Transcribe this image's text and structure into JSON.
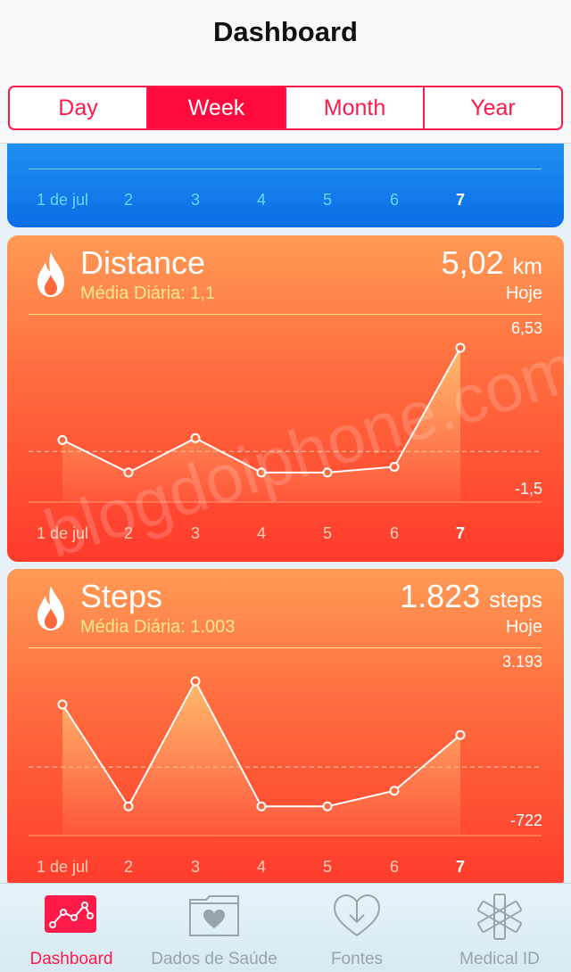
{
  "header": {
    "title": "Dashboard"
  },
  "segments": [
    {
      "label": "Day",
      "active": false
    },
    {
      "label": "Week",
      "active": true
    },
    {
      "label": "Month",
      "active": false
    },
    {
      "label": "Year",
      "active": false
    }
  ],
  "days": [
    "1 de jul",
    "2",
    "3",
    "4",
    "5",
    "6",
    "7"
  ],
  "cards": [
    {
      "title": "Distance",
      "subtitle": "Média Diária: 1,1",
      "value": "5,02",
      "unit": "km",
      "today_label": "Hoje",
      "max_label": "6,53",
      "min_label": "-1,5",
      "icon": "flame-icon"
    },
    {
      "title": "Steps",
      "subtitle": "Média Diária: 1.003",
      "value": "1.823",
      "unit": "steps",
      "today_label": "Hoje",
      "max_label": "3.193",
      "min_label": "-722",
      "icon": "flame-icon"
    }
  ],
  "chart_data": [
    {
      "type": "area",
      "title": "Distance",
      "categories": [
        "1 de jul",
        "2",
        "3",
        "4",
        "5",
        "6",
        "7"
      ],
      "values": [
        1.7,
        0.0,
        1.8,
        0.0,
        0.0,
        0.3,
        6.53
      ],
      "ylim": [
        -1.5,
        6.53
      ],
      "average": 1.1
    },
    {
      "type": "area",
      "title": "Steps",
      "categories": [
        "1 de jul",
        "2",
        "3",
        "4",
        "5",
        "6",
        "7"
      ],
      "values": [
        2600,
        0,
        3193,
        0,
        0,
        400,
        1823
      ],
      "ylim": [
        -722,
        3193
      ],
      "average": 1003
    }
  ],
  "tabbar": {
    "items": [
      {
        "label": "Dashboard",
        "icon": "chart-icon",
        "active": true
      },
      {
        "label": "Dados de Saúde",
        "icon": "health-folder-icon",
        "active": false
      },
      {
        "label": "Fontes",
        "icon": "heart-download-icon",
        "active": false
      },
      {
        "label": "Medical ID",
        "icon": "asterisk-icon",
        "active": false
      }
    ]
  },
  "watermark": "blogdoiphone.com",
  "colors": {
    "accent": "#ff1a4a",
    "blue": "#0a6ee6",
    "orange_top": "#ff9a55",
    "orange_bottom": "#ff3a2c"
  }
}
